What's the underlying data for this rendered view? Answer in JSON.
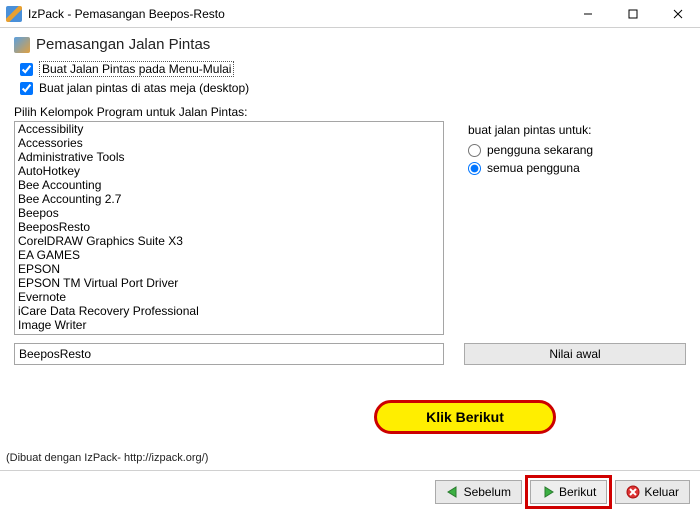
{
  "window": {
    "title": "IzPack - Pemasangan Beepos-Resto"
  },
  "section": {
    "heading": "Pemasangan Jalan Pintas",
    "check_start_menu": "Buat Jalan Pintas pada Menu-Mulai",
    "check_desktop": "Buat jalan pintas di atas meja (desktop)",
    "list_label": "Pilih Kelompok Program untuk Jalan Pintas:",
    "items": [
      "Accessibility",
      "Accessories",
      "Administrative Tools",
      "AutoHotkey",
      "Bee Accounting",
      "Bee Accounting 2.7",
      "Beepos",
      "BeeposResto",
      "CorelDRAW Graphics Suite X3",
      "EA GAMES",
      "EPSON",
      "EPSON TM Virtual Port Driver",
      "Evernote",
      "iCare Data Recovery Professional",
      "Image Writer"
    ],
    "group_input": "BeeposResto",
    "reset_button": "Nilai awal"
  },
  "right": {
    "label": "buat jalan pintas untuk:",
    "radio_current": "pengguna sekarang",
    "radio_all": "semua pengguna"
  },
  "callout": {
    "text": "Klik Berikut"
  },
  "footer_note": "(Dibuat dengan IzPack- http://izpack.org/)",
  "buttons": {
    "prev": "Sebelum",
    "next": "Berikut",
    "quit": "Keluar"
  }
}
